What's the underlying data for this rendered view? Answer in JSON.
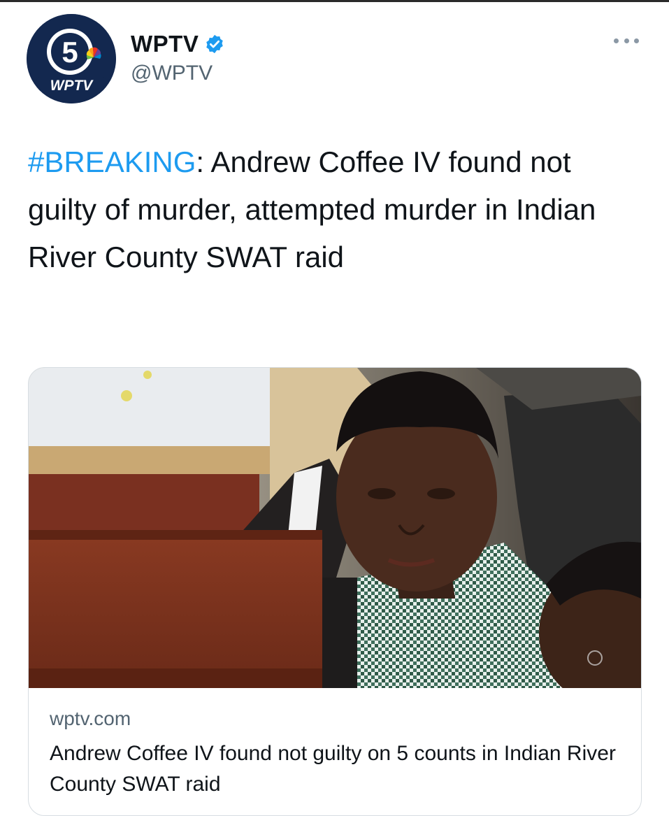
{
  "tweet": {
    "author": {
      "display_name": "WPTV",
      "handle": "@WPTV",
      "verified": true,
      "avatar_label": "WPTV",
      "avatar_channel": "5"
    },
    "text": {
      "hashtag": "#BREAKING",
      "body": ": Andrew Coffee IV found not guilty of murder, attempted murder in Indian River County SWAT raid"
    },
    "card": {
      "domain": "wptv.com",
      "title": "Andrew Coffee IV found not guilty on 5 counts in Indian River County SWAT raid"
    }
  },
  "colors": {
    "link_blue": "#1d9bf0",
    "verified_blue": "#1d9bf0",
    "secondary_text": "#536471",
    "avatar_navy": "#13284f"
  },
  "icons": {
    "verified": "verified-badge-icon",
    "more": "more-options-icon"
  }
}
